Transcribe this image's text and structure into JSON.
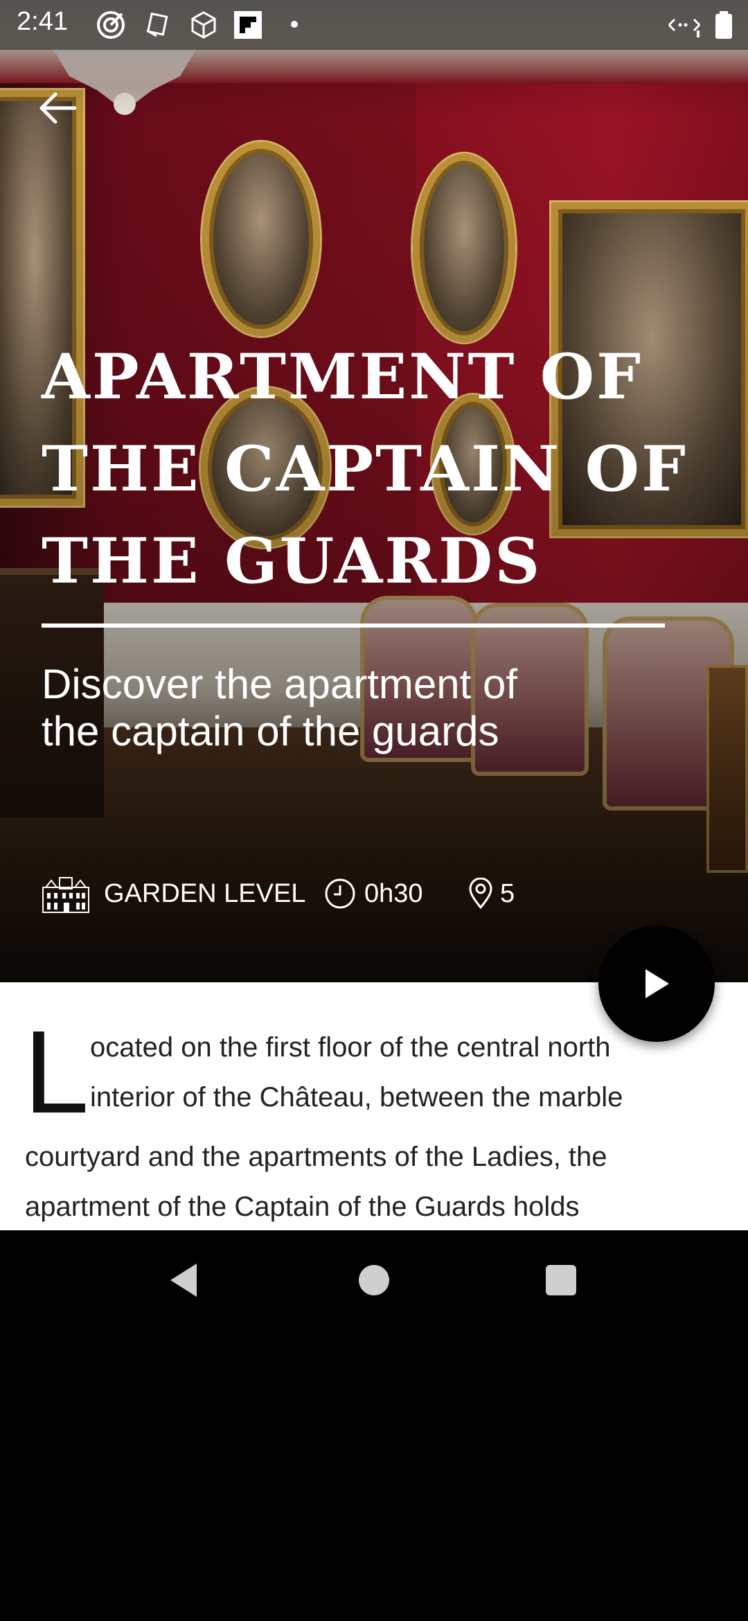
{
  "status_bar": {
    "time": "2:41",
    "icons": [
      "target-app-icon",
      "puzzle-app-icon",
      "cube-app-icon",
      "flipboard-icon",
      "notification-dot",
      "network-icon",
      "battery-icon"
    ]
  },
  "hero": {
    "title_lines": [
      "APARTMENT OF",
      "THE CAPTAIN OF",
      "THE GUARDS"
    ],
    "subtitle_lines": [
      "Discover the apartment of",
      "the captain of the guards"
    ],
    "meta": {
      "level": "GARDEN LEVEL",
      "duration": "0h30",
      "stops": "5"
    }
  },
  "content": {
    "dropcap": "L",
    "lines": [
      "ocated on the first floor of the central north",
      "interior of the Château, between the marble",
      "courtyard and the apartments of the Ladies, the",
      "apartment of the Captain of the Guards holds"
    ]
  },
  "colors": {
    "wall_red": "#860f1f",
    "gold_frame": "#c79a3a",
    "text_white": "#ffffff",
    "play_button": "#000000"
  }
}
